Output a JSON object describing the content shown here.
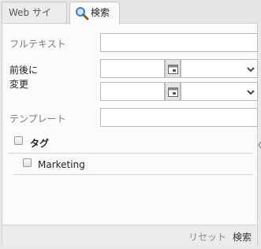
{
  "tabs": {
    "website_label": "Web サイト",
    "search_label": "検索"
  },
  "form": {
    "fulltext_label": "フルテキスト",
    "fulltext_value": "",
    "relative_label_line1": "前後に",
    "relative_label_line2": "変更",
    "date_from_value": "",
    "time_from_value": "",
    "date_to_value": "",
    "time_to_value": "",
    "template_label": "テンプレート",
    "template_value": ""
  },
  "tags": {
    "heading": "タグ",
    "items": [
      {
        "label": "Marketing",
        "checked": false
      }
    ]
  },
  "footer": {
    "reset_label": "リセット",
    "search_label": "検索"
  },
  "colors": {
    "panel_bg": "#fbfbfb",
    "border": "#b9b9b9",
    "label_gray": "#7a7a7a"
  }
}
